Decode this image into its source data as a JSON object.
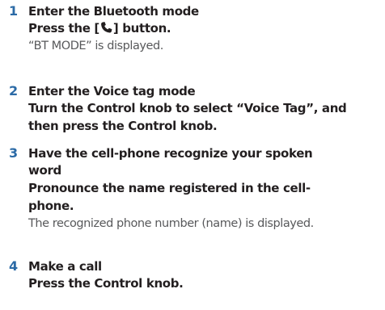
{
  "steps": [
    {
      "number": "1",
      "heading": "Enter the Bluetooth mode",
      "instruction_before": "Press the [",
      "instruction_icon": "phone-handset-icon",
      "instruction_after": "] button.",
      "result": "“BT MODE” is displayed."
    },
    {
      "number": "2",
      "heading": "Enter the Voice tag mode",
      "instruction_lines": [
        "Turn the Control knob to select “Voice Tag”, and",
        "then press the Control knob."
      ]
    },
    {
      "number": "3",
      "heading_lines": [
        "Have the cell-phone recognize your spoken",
        "word"
      ],
      "instruction_lines": [
        "Pronounce the name registered in the cell-",
        "phone."
      ],
      "result": "The recognized phone number (name) is displayed."
    },
    {
      "number": "4",
      "heading": "Make a call",
      "instruction": "Press the Control knob."
    }
  ],
  "colors": {
    "step_number": "#2b6aa6",
    "heading_text": "#231f20",
    "result_text": "#58595b"
  }
}
